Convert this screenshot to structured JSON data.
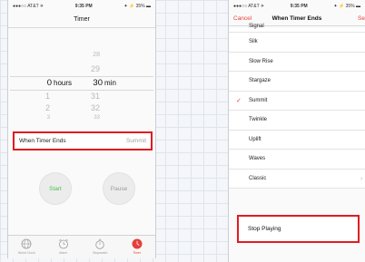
{
  "left_screen": {
    "status": {
      "carrier": "●●●○○ AT&T ✈",
      "time": "9:35 PM",
      "battery": "✦ ⚡ 35% ▬"
    },
    "title": "Timer",
    "picker": {
      "hours_above": [
        "",
        "",
        ""
      ],
      "hours_selected": "0",
      "hours_below": [
        "1",
        "2",
        "3"
      ],
      "hours_unit": "hours",
      "minutes_above": [
        "28",
        "29"
      ],
      "minutes_selected": "30",
      "minutes_below": [
        "31",
        "32",
        "33"
      ],
      "minutes_unit": "min"
    },
    "timer_ends": {
      "label": "When Timer Ends",
      "value": "Summit"
    },
    "start_label": "Start",
    "pause_label": "Pause",
    "tabs": [
      {
        "label": "World Clock",
        "icon": "globe-icon"
      },
      {
        "label": "Alarm",
        "icon": "alarm-clock-icon"
      },
      {
        "label": "Stopwatch",
        "icon": "stopwatch-icon"
      },
      {
        "label": "Timer",
        "icon": "timer-icon",
        "active": true
      }
    ]
  },
  "right_screen": {
    "status": {
      "carrier": "●●●○○ AT&T ✈",
      "time": "9:35 PM",
      "battery": "✦ ⚡ 35% ▬"
    },
    "nav": {
      "cancel": "Cancel",
      "title": "When Timer Ends",
      "set": "Se"
    },
    "sounds": [
      {
        "label": "Signal"
      },
      {
        "label": "Silk"
      },
      {
        "label": "Slow Rise"
      },
      {
        "label": "Stargaze"
      },
      {
        "label": "Summit",
        "checked": true
      },
      {
        "label": "Twinkle"
      },
      {
        "label": "Uplift"
      },
      {
        "label": "Waves"
      },
      {
        "label": "Classic",
        "has_chevron": true
      }
    ],
    "stop_playing": "Stop Playing"
  },
  "colors": {
    "accent_red": "#e5403a",
    "highlight_box": "#e01b22",
    "start_green": "#4cc24c"
  }
}
